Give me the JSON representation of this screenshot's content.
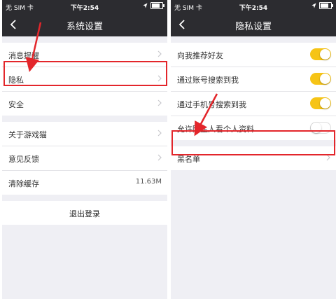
{
  "status_bar": {
    "carrier": "无 SIM 卡",
    "time": "下午2:54"
  },
  "left_screen": {
    "title": "系统设置",
    "group1": [
      {
        "label": "消息提醒"
      },
      {
        "label": "隐私"
      },
      {
        "label": "安全"
      }
    ],
    "group2": [
      {
        "label": "关于游戏猫"
      },
      {
        "label": "意见反馈"
      },
      {
        "label": "清除缓存",
        "value": "11.63M"
      }
    ],
    "logout_label": "退出登录"
  },
  "right_screen": {
    "title": "隐私设置",
    "toggles": [
      {
        "label": "向我推荐好友",
        "on": true
      },
      {
        "label": "通过账号搜索到我",
        "on": true
      },
      {
        "label": "通过手机号搜索到我",
        "on": true
      },
      {
        "label": "允许陌生人看个人资料",
        "on": false
      }
    ],
    "blacklist_label": "黑名单"
  },
  "colors": {
    "header": "#2c2c30",
    "toggle_on": "#f6c416",
    "highlight": "#e3262b",
    "background": "#efeff4"
  },
  "icons": [
    "back-chevron-icon",
    "chevron-right-icon",
    "wifi-icon",
    "location-icon",
    "battery-icon",
    "red-arrow-icon"
  ]
}
